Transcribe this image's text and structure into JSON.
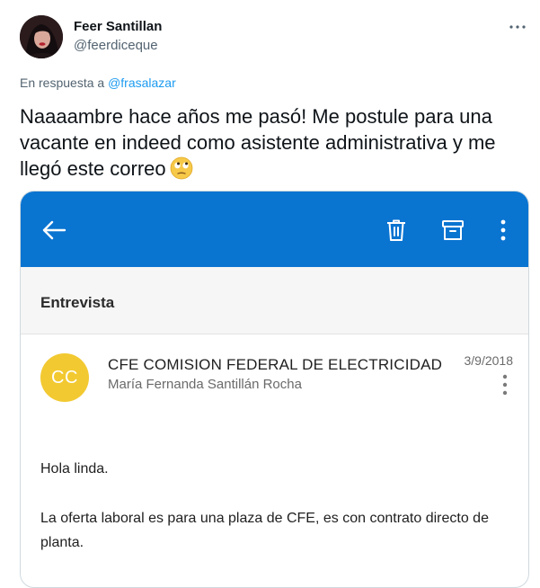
{
  "tweet": {
    "display_name": "Feer Santillan",
    "handle": "@feerdiceque",
    "reply_prefix": "En respuesta a",
    "reply_to": "@frasalazar",
    "text": "Naaaambre hace años me pasó! Me postule para una vacante en indeed como asistente administrativa y me llegó este correo",
    "emoji": "face-with-rolling-eyes-emoji",
    "more_icon": "ellipsis-icon"
  },
  "email": {
    "app_bar_color": "#0a74d1",
    "icons": [
      "back-arrow-icon",
      "trash-icon",
      "archive-icon",
      "more-vertical-icon"
    ],
    "subject": "Entrevista",
    "sender_initials": "CC",
    "sender_avatar_color": "#f2c931",
    "sender_name": "CFE COMISION FEDERAL DE ELECTRICIDAD",
    "recipient": "María Fernanda Santillán Rocha",
    "date": "3/9/2018",
    "greeting": "Hola linda.",
    "paragraph": "La oferta laboral es para una plaza de CFE, es con contrato directo de planta."
  }
}
